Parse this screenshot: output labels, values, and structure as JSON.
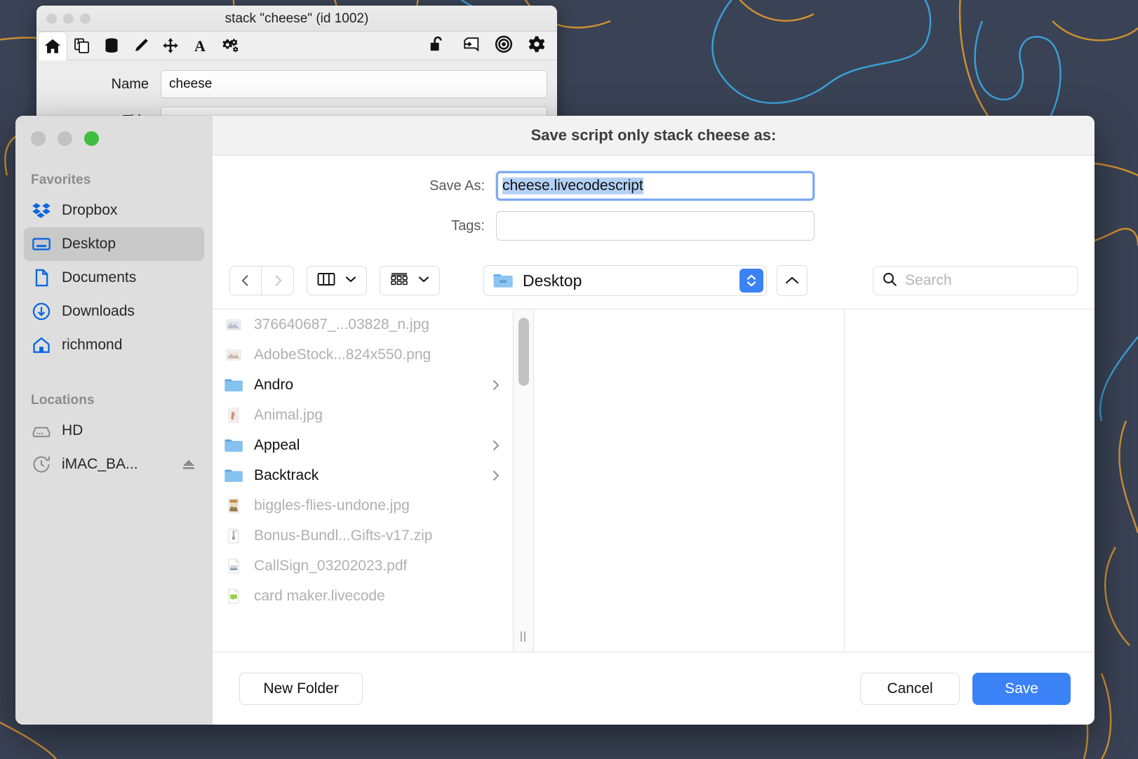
{
  "desktop": {
    "background_color": "#3a4355",
    "line_colors": [
      "#d9962f",
      "#3aa7e0"
    ]
  },
  "stack_window": {
    "title": "stack \"cheese\" (id 1002)",
    "traffic_lights": [
      "close-disabled",
      "minimize-disabled",
      "zoom-disabled"
    ],
    "toolbar_left": [
      {
        "name": "home-icon",
        "label": "Home",
        "active": true
      },
      {
        "name": "copy-cards-icon",
        "label": "Cards"
      },
      {
        "name": "stack-database-icon",
        "label": "Stack"
      },
      {
        "name": "pencil-icon",
        "label": "Edit"
      },
      {
        "name": "move-arrows-icon",
        "label": "Move"
      },
      {
        "name": "text-a-icon",
        "label": "Text"
      },
      {
        "name": "gears-icon",
        "label": "Options"
      }
    ],
    "toolbar_right": [
      {
        "name": "unlock-padlock-icon",
        "label": "Unlock"
      },
      {
        "name": "script-hand-icon",
        "label": "Script"
      },
      {
        "name": "target-bullseye-icon",
        "label": "Target"
      },
      {
        "name": "gear-icon",
        "label": "Settings"
      }
    ],
    "fields": [
      {
        "label": "Name",
        "value": "cheese"
      },
      {
        "label": "Title",
        "value": ""
      }
    ]
  },
  "dialog": {
    "title": "Save script only stack cheese as:",
    "traffic_lights": [
      {
        "name": "close-button",
        "color": "#c2c2c2",
        "enabled": false
      },
      {
        "name": "minimize-button",
        "color": "#c2c2c2",
        "enabled": false
      },
      {
        "name": "zoom-button",
        "color": "#3fbf3f",
        "enabled": true
      }
    ],
    "save_as": {
      "label": "Save As:",
      "value": "cheese.livecodescript",
      "selected": true,
      "focused": true
    },
    "tags": {
      "label": "Tags:",
      "value": "",
      "placeholder": ""
    },
    "nav": {
      "back_label": "Back",
      "forward_label": "Forward",
      "view_mode": "column-view",
      "group_mode": "group-by",
      "path_label": "Desktop",
      "up_label": "Up"
    },
    "search": {
      "placeholder": "Search"
    },
    "footer": {
      "new_folder_label": "New Folder",
      "cancel_label": "Cancel",
      "save_label": "Save"
    },
    "accent_color": "#3b82f6"
  },
  "sidebar": {
    "sections": [
      {
        "header": "Favorites",
        "items": [
          {
            "label": "Dropbox",
            "icon": "dropbox-icon",
            "selected": false
          },
          {
            "label": "Desktop",
            "icon": "desktop-monitor-icon",
            "selected": true
          },
          {
            "label": "Documents",
            "icon": "document-page-icon",
            "selected": false
          },
          {
            "label": "Downloads",
            "icon": "downloads-arrow-icon",
            "selected": false
          },
          {
            "label": "richmond",
            "icon": "home-house-icon",
            "selected": false
          }
        ]
      },
      {
        "header": "Locations",
        "items": [
          {
            "label": "HD",
            "icon": "hard-drive-icon",
            "selected": false
          },
          {
            "label": "iMAC_BA...",
            "icon": "time-machine-icon",
            "selected": false,
            "eject": true
          }
        ]
      }
    ]
  },
  "file_list": [
    {
      "name": "376640687_...03828_n.jpg",
      "type": "image-file",
      "enabled": false
    },
    {
      "name": "AdobeStock...824x550.png",
      "type": "image-file",
      "enabled": false
    },
    {
      "name": "Andro",
      "type": "folder",
      "enabled": true
    },
    {
      "name": "Animal.jpg",
      "type": "image-file",
      "enabled": false
    },
    {
      "name": "Appeal",
      "type": "folder",
      "enabled": true
    },
    {
      "name": "Backtrack",
      "type": "folder",
      "enabled": true
    },
    {
      "name": "biggles-flies-undone.jpg",
      "type": "image-file",
      "enabled": false
    },
    {
      "name": "Bonus-Bundl...Gifts-v17.zip",
      "type": "zip-file",
      "enabled": false
    },
    {
      "name": "CallSign_03202023.pdf",
      "type": "pdf-file",
      "enabled": false
    },
    {
      "name": "card maker.livecode",
      "type": "livecode-file",
      "enabled": false
    }
  ]
}
